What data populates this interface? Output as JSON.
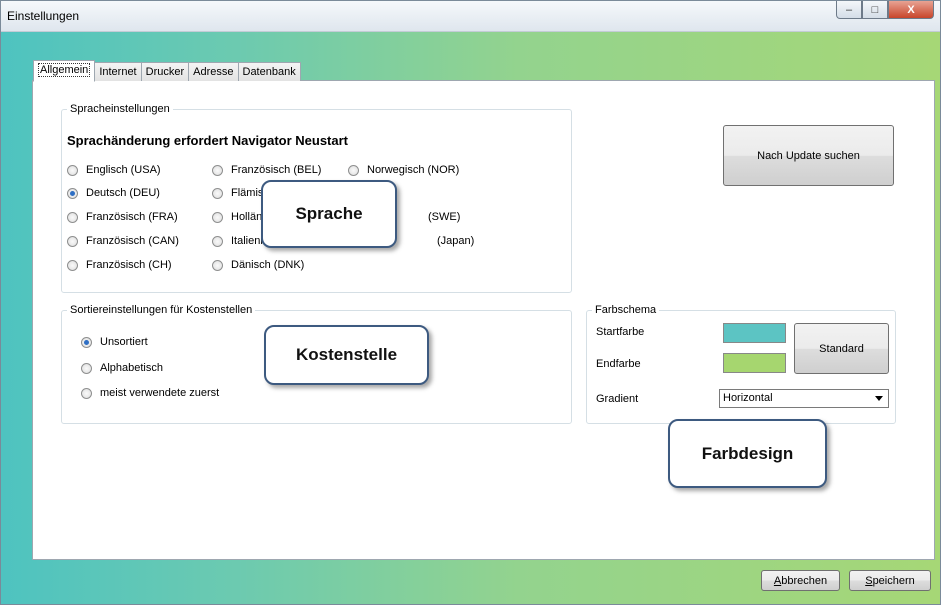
{
  "window": {
    "title": "Einstellungen",
    "controls": {
      "minimize": "–",
      "maximize": "□",
      "close": "X"
    }
  },
  "tabs": [
    "Allgemein",
    "Internet",
    "Drucker",
    "Adresse",
    "Datenbank"
  ],
  "language": {
    "group_label": "Spracheinstellungen",
    "notice": "Sprachänderung erfordert Navigator Neustart",
    "options": [
      {
        "label": "Englisch (USA)",
        "selected": false
      },
      {
        "label": "Deutsch (DEU)",
        "selected": true
      },
      {
        "label": "Französisch (FRA)",
        "selected": false
      },
      {
        "label": "Französisch (CAN)",
        "selected": false
      },
      {
        "label": "Französisch (CH)",
        "selected": false
      },
      {
        "label": "Französisch (BEL)",
        "selected": false
      },
      {
        "label": "Flämisch",
        "selected": false
      },
      {
        "label": "Holländisch",
        "selected": false
      },
      {
        "label": "Italienisch",
        "selected": false
      },
      {
        "label": "Dänisch (DNK)",
        "selected": false
      },
      {
        "label": "Norwegisch (NOR)",
        "selected": false
      },
      {
        "label": "(SWE)",
        "selected": false
      },
      {
        "label": "(Japan)",
        "selected": false
      }
    ]
  },
  "update_button": "Nach Update suchen",
  "cost_center": {
    "group_label": "Sortiereinstellungen für Kostenstellen",
    "options": [
      {
        "label": "Unsortiert",
        "selected": true
      },
      {
        "label": "Alphabetisch",
        "selected": false
      },
      {
        "label": "meist verwendete zuerst",
        "selected": false
      }
    ]
  },
  "color_scheme": {
    "group_label": "Farbschema",
    "start_label": "Startfarbe",
    "end_label": "Endfarbe",
    "start_color": "#5cc4c3",
    "end_color": "#a6d66f",
    "standard_button": "Standard",
    "gradient_label": "Gradient",
    "gradient_value": "Horizontal"
  },
  "callouts": {
    "language": "Sprache",
    "cost_center": "Kostenstelle",
    "color_design": "Farbdesign"
  },
  "footer": {
    "cancel_first": "A",
    "cancel_rest": "bbrechen",
    "save_first": "S",
    "save_rest": "peichern"
  }
}
